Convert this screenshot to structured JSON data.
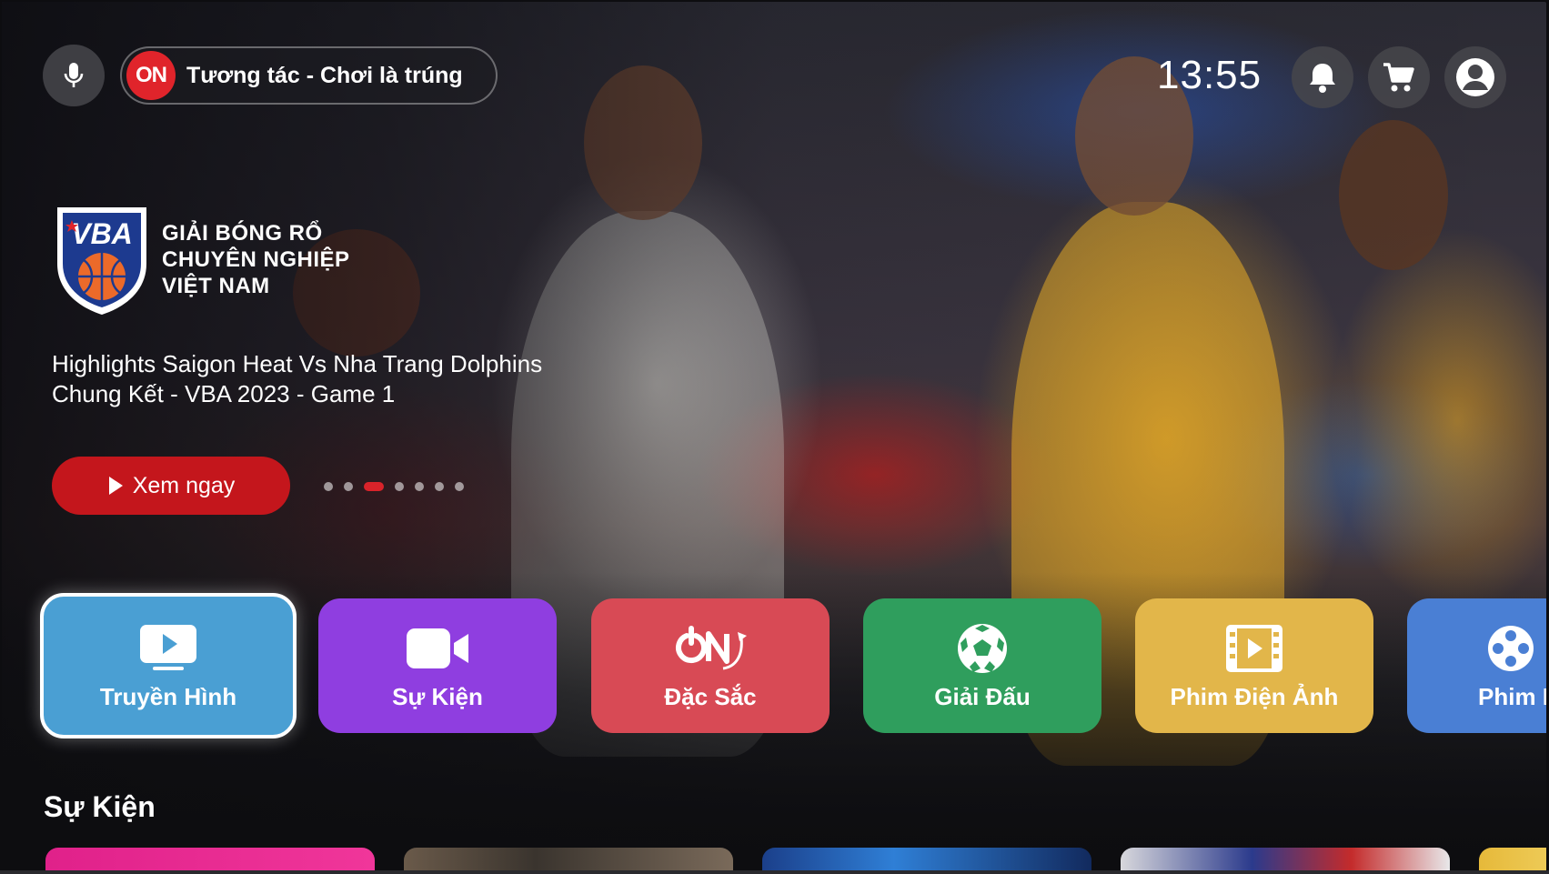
{
  "header": {
    "promo_badge": "ON",
    "promo_text": "Tương tác - Chơi là trúng",
    "clock": "13:55"
  },
  "hero": {
    "league_logo_text": "VBA",
    "league_title_lines": [
      "GIẢI BÓNG RỔ",
      "CHUYÊN NGHIỆP",
      "VIỆT NAM"
    ],
    "title_lines": [
      "Highlights Saigon Heat Vs Nha Trang Dolphins",
      "Chung Kết - VBA 2023 - Game 1"
    ],
    "watch_label": "Xem ngay",
    "carousel": {
      "count": 7,
      "active_index": 2
    }
  },
  "categories": [
    {
      "label": "Truyền Hình",
      "icon": "tv-icon",
      "color": "#4a9fd3",
      "selected": true
    },
    {
      "label": "Sự Kiện",
      "icon": "video-camera-icon",
      "color": "#8f3ee0"
    },
    {
      "label": "Đặc Sắc",
      "icon": "on-logo-icon",
      "color": "#d84a55"
    },
    {
      "label": "Giải Đấu",
      "icon": "soccer-ball-icon",
      "color": "#2f9e5d"
    },
    {
      "label": "Phim Điện Ảnh",
      "icon": "film-icon",
      "color": "#e2b64a"
    },
    {
      "label": "Phim Bộ",
      "visible_label": "Phim I",
      "icon": "film-reel-icon",
      "color": "#4a7fd4"
    }
  ],
  "section": {
    "title": "Sự Kiện"
  },
  "colors": {
    "accent_red": "#c4161c",
    "on_red": "#e0242b"
  }
}
